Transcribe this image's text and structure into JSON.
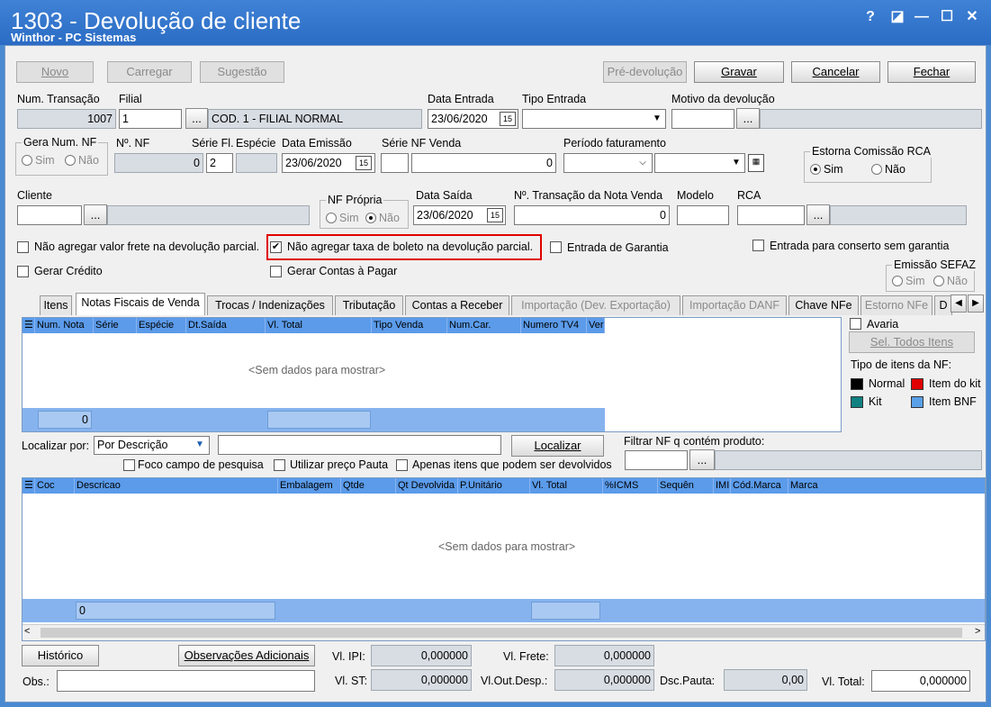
{
  "window": {
    "title": "1303 - Devolução de cliente",
    "subtitle": "Winthor - PC Sistemas",
    "help": "?",
    "restore": "◪",
    "minimize": "—",
    "maximize": "☐",
    "close": "✕"
  },
  "toolbar": {
    "novo": "Novo",
    "carregar": "Carregar",
    "sugestao": "Sugestão",
    "pre_devolucao": "Pré-devolução",
    "gravar": "Gravar",
    "cancelar": "Cancelar",
    "fechar": "Fechar"
  },
  "row1": {
    "num_transacao_label": "Num. Transação",
    "num_transacao": "1007",
    "filial_label": "Filial",
    "filial": "1",
    "filial_btn": "...",
    "filial_desc": "COD. 1 - FILIAL NORMAL",
    "data_entrada_label": "Data Entrada",
    "data_entrada": "23/06/2020",
    "tipo_entrada_label": "Tipo Entrada",
    "tipo_entrada": "",
    "motivo_label": "Motivo da devolução",
    "motivo": "",
    "motivo_btn": "..."
  },
  "row2": {
    "gera_num_nf_label": "Gera Num. NF",
    "sim": "Sim",
    "nao": "Não",
    "num_nf_label": "Nº. NF",
    "num_nf": "0",
    "serie_label": "Série Fl.",
    "serie": "2",
    "especie_label": "Espécie",
    "especie": "",
    "data_emissao_label": "Data Emissão",
    "data_emissao": "23/06/2020",
    "serie_nf_venda_label": "Série NF Venda",
    "serie_nf_venda": "",
    "nf_venda": "0",
    "periodo_label": "Período faturamento",
    "estorna_label": "Estorna Comissão RCA",
    "estorna_sim": "Sim",
    "estorna_nao": "Não"
  },
  "row3": {
    "cliente_label": "Cliente",
    "cliente_btn": "...",
    "nf_propria_label": "NF Própria",
    "nf_sim": "Sim",
    "nf_nao": "Não",
    "data_saida_label": "Data Saída",
    "data_saida": "23/06/2020",
    "num_trans_venda_label": "Nº. Transação da Nota Venda",
    "num_trans_venda": "0",
    "modelo_label": "Modelo",
    "rca_label": "RCA",
    "rca_btn": "..."
  },
  "options": {
    "nao_agregar_frete": "Não agregar valor frete na devolução parcial.",
    "nao_agregar_taxa": "Não agregar taxa de boleto na devolução parcial.",
    "entrada_garantia": "Entrada de Garantia",
    "entrada_conserto": "Entrada para conserto sem garantia",
    "gerar_credito": "Gerar Crédito",
    "gerar_contas": "Gerar Contas à Pagar",
    "emissao_sefaz": "Emissão SEFAZ",
    "sefaz_sim": "Sim",
    "sefaz_nao": "Não",
    "check_mark": "✔",
    "highlight_color": "#e00000"
  },
  "tabs": [
    "Itens",
    "Notas Fiscais de Venda",
    "Trocas / Indenizações",
    "Tributação",
    "Contas a Receber",
    "Importação (Dev. Exportação)",
    "Importação DANF",
    "Chave NFe",
    "Estorno NFe",
    "D"
  ],
  "grid1": {
    "columns": [
      "Num. Nota",
      "Série",
      "Espécie",
      "Dt.Saída",
      "Vl. Total",
      "Tipo Venda",
      "Num.Car.",
      "Numero TV4",
      "Ver"
    ],
    "empty": "<Sem dados para mostrar>",
    "footer_count": "0"
  },
  "side": {
    "avaria": "Avaria",
    "sel_todos": "Sel. Todos Itens",
    "tipo_itens": "Tipo de itens da NF:",
    "normal": "Normal",
    "item_kit": "Item do kit",
    "kit": "Kit",
    "item_bnf": "Item BNF",
    "c_normal": "#000000",
    "c_item_kit": "#e00000",
    "c_kit": "#118080",
    "c_bnf": "#5aa0e8"
  },
  "search": {
    "localizar_por_label": "Localizar por:",
    "localizar_por": "Por Descrição",
    "localizar_btn": "Localizar",
    "filtrar_label": "Filtrar NF q contém produto:",
    "filtrar_btn": "...",
    "foco": "Foco campo de pesquisa",
    "utilizar_preco": "Utilizar preço Pauta",
    "apenas_itens": "Apenas itens que podem ser devolvidos"
  },
  "grid2": {
    "columns": [
      "Coc",
      "Descricao",
      "Embalagem",
      "Qtde",
      "Qt Devolvida",
      "P.Unitário",
      "Vl. Total",
      "%ICMS",
      "Sequên",
      "IMI",
      "Cód.Marca",
      "Marca"
    ],
    "empty": "<Sem dados para mostrar>",
    "footer_count": "0"
  },
  "bottom": {
    "historico": "Histórico",
    "obs_adicionais": "Observações Adicionais",
    "vl_ipi_label": "Vl. IPI:",
    "vl_ipi": "0,000000",
    "vl_frete_label": "Vl. Frete:",
    "vl_frete": "0,000000",
    "obs_label": "Obs.:",
    "vl_st_label": "Vl. ST:",
    "vl_st": "0,000000",
    "vl_out_label": "Vl.Out.Desp.:",
    "vl_out": "0,000000",
    "dsc_pauta_label": "Dsc.Pauta:",
    "dsc_pauta": "0,00",
    "vl_total_label": "Vl. Total:",
    "vl_total": "0,000000"
  }
}
